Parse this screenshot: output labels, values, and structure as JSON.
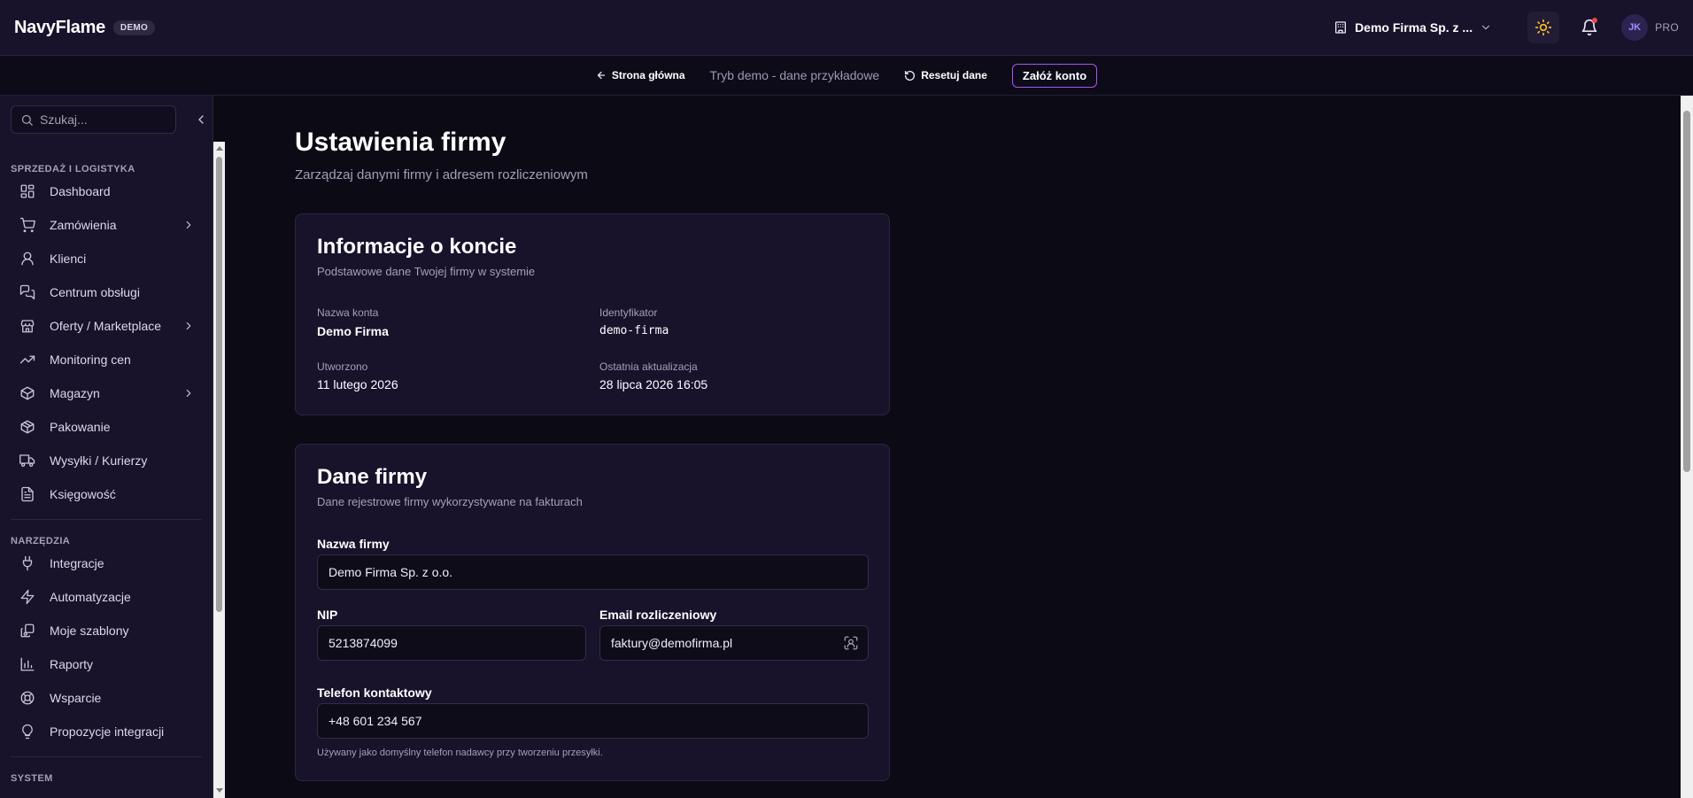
{
  "header": {
    "logo": "NavyFlame",
    "badge": "DEMO",
    "company": "Demo Firma Sp. z ...",
    "avatar_initials": "JK",
    "plan": "PRO"
  },
  "demo_bar": {
    "home": "Strona główna",
    "mode": "Tryb demo - dane przykładowe",
    "reset": "Resetuj dane",
    "signup": "Załóż konto"
  },
  "sidebar": {
    "search_placeholder": "Szukaj...",
    "section_sales": "SPRZEDAŻ I LOGISTYKA",
    "sales_items": [
      {
        "label": "Dashboard",
        "icon": "grid-icon"
      },
      {
        "label": "Zamówienia",
        "icon": "cart-icon",
        "submenu": true
      },
      {
        "label": "Klienci",
        "icon": "user-icon"
      },
      {
        "label": "Centrum obsługi",
        "icon": "chat-icon"
      },
      {
        "label": "Oferty / Marketplace",
        "icon": "store-icon",
        "submenu": true
      },
      {
        "label": "Monitoring cen",
        "icon": "trending-icon"
      },
      {
        "label": "Magazyn",
        "icon": "box-icon",
        "submenu": true
      },
      {
        "label": "Pakowanie",
        "icon": "package-icon"
      },
      {
        "label": "Wysyłki / Kurierzy",
        "icon": "truck-icon"
      },
      {
        "label": "Księgowość",
        "icon": "document-icon"
      }
    ],
    "section_tools": "NARZĘDZIA",
    "tools_items": [
      {
        "label": "Integracje",
        "icon": "plug-icon"
      },
      {
        "label": "Automatyzacje",
        "icon": "bolt-icon"
      },
      {
        "label": "Moje szablony",
        "icon": "templates-icon"
      },
      {
        "label": "Raporty",
        "icon": "bar-chart-icon"
      },
      {
        "label": "Wsparcie",
        "icon": "lifebuoy-icon"
      },
      {
        "label": "Propozycje integracji",
        "icon": "lightbulb-icon"
      }
    ],
    "section_system": "SYSTEM"
  },
  "page": {
    "title": "Ustawienia firmy",
    "subtitle": "Zarządzaj danymi firmy i adresem rozliczeniowym"
  },
  "account_card": {
    "title": "Informacje o koncie",
    "subtitle": "Podstawowe dane Twojej firmy w systemie",
    "account_name_label": "Nazwa konta",
    "account_name": "Demo Firma",
    "identifier_label": "Identyfikator",
    "identifier": "demo-firma",
    "created_label": "Utworzono",
    "created": "11 lutego 2026",
    "updated_label": "Ostatnia aktualizacja",
    "updated": "28 lipca 2026 16:05"
  },
  "company_card": {
    "title": "Dane firmy",
    "subtitle": "Dane rejestrowe firmy wykorzystywane na fakturach",
    "name_label": "Nazwa firmy",
    "name_value": "Demo Firma Sp. z o.o.",
    "nip_label": "NIP",
    "nip_value": "5213874099",
    "email_label": "Email rozliczeniowy",
    "email_value": "faktury@demofirma.pl",
    "phone_label": "Telefon kontaktowy",
    "phone_value": "+48 601 234 567",
    "phone_hint": "Używany jako domyślny telefon nadawcy przy tworzeniu przesyłki."
  },
  "colors": {
    "accent": "#a855f7",
    "sun": "#fbbf24",
    "notification": "#ef4444"
  }
}
